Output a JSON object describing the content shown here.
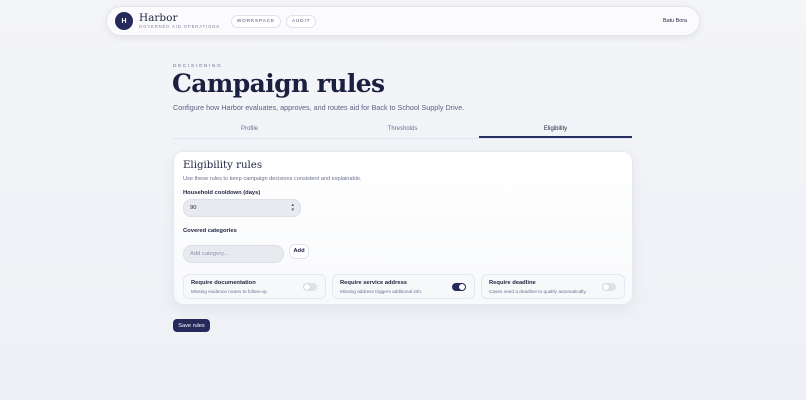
{
  "app": {
    "logo_letter": "H",
    "brand_name": "Harbor",
    "brand_tagline": "GOVERNED AID OPERATIONS",
    "nav": [
      "WORKSPACE",
      "AUDIT"
    ],
    "user_name": "Batu Bora"
  },
  "page": {
    "eyebrow": "DECISIONING",
    "title": "Campaign rules",
    "subtitle": "Configure how Harbor evaluates, approves, and routes aid for Back to School Supply Drive."
  },
  "tabs": [
    {
      "label": "Profile",
      "active": false
    },
    {
      "label": "Thresholds",
      "active": false
    },
    {
      "label": "Eligibility",
      "active": true
    }
  ],
  "eligibility": {
    "title": "Eligibility rules",
    "subtitle": "Use these rules to keep campaign decisions consistent and explainable.",
    "cooldown_label": "Household cooldown (days)",
    "cooldown_value": "90",
    "categories_label": "Covered categories",
    "category_placeholder": "Add category...",
    "add_label": "Add",
    "toggles": [
      {
        "title": "Require documentation",
        "desc": "Missing evidence routes to follow-up.",
        "on": false
      },
      {
        "title": "Require service address",
        "desc": "Missing address triggers additional info.",
        "on": true
      },
      {
        "title": "Require deadline",
        "desc": "Cases need a deadline to qualify automatically.",
        "on": false
      }
    ]
  },
  "actions": {
    "save_label": "Save rules"
  },
  "colors": {
    "accent": "#262a5a",
    "background": "#f2f3f7"
  }
}
